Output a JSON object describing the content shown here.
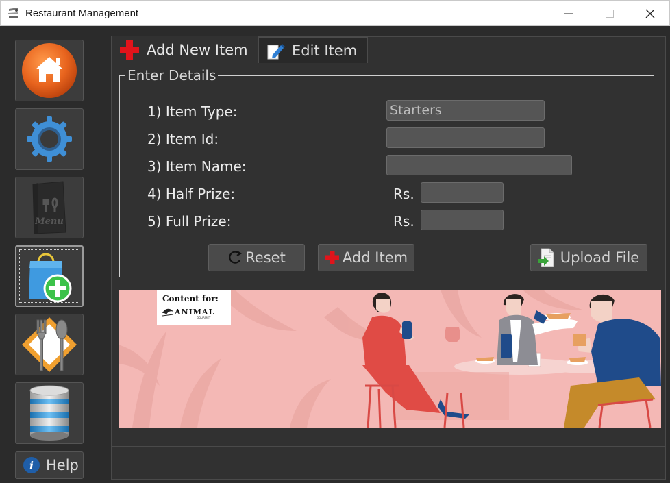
{
  "window": {
    "title": "Restaurant Management",
    "min_glyph": "—",
    "max_glyph": "☐",
    "close_glyph": "✕"
  },
  "sidebar": {
    "items": [
      {
        "name": "home",
        "icon": "home-icon"
      },
      {
        "name": "settings",
        "icon": "gear-icon"
      },
      {
        "name": "menu",
        "icon": "menu-card-icon",
        "icon_text": "Menu"
      },
      {
        "name": "add-item",
        "icon": "shopping-bag-plus-icon",
        "active": true
      },
      {
        "name": "dining",
        "icon": "fork-spoon-icon"
      },
      {
        "name": "database",
        "icon": "database-icon"
      }
    ],
    "help": {
      "label": "Help",
      "icon": "info-icon"
    }
  },
  "tabs": [
    {
      "label": "Add New Item",
      "icon": "red-plus-icon",
      "active": true
    },
    {
      "label": "Edit Item",
      "icon": "edit-pencil-icon",
      "active": false
    }
  ],
  "form": {
    "legend": "Enter Details",
    "item_type_label": "1) Item Type:",
    "item_type_value": "Starters",
    "item_id_label": "2) Item Id:",
    "item_id_value": "",
    "item_name_label": "3) Item Name:",
    "item_name_value": "",
    "half_prize_label": "4) Half Prize:",
    "half_prize_value": "",
    "full_prize_label": "5) Full Prize:",
    "full_prize_value": "",
    "currency": "Rs."
  },
  "buttons": {
    "reset": "Reset",
    "add_item": "Add Item",
    "upload_file": "Upload File"
  },
  "banner": {
    "content_for": "Content for:",
    "brand": "ANIMAL",
    "brand_sub": "GOURMET"
  },
  "colors": {
    "accent_orange": "#e8641e",
    "accent_blue": "#3f8fd6",
    "plus_red": "#e0141b",
    "plus_green": "#3cc24a",
    "banner_pink": "#f4b8b5",
    "dress_red": "#e04b45"
  }
}
